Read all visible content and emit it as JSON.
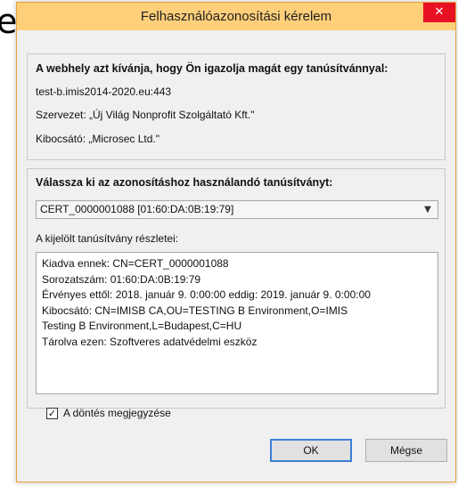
{
  "background": {
    "letter": "e"
  },
  "window": {
    "title": "Felhasználóazonosítási kérelem",
    "close_glyph": "✕",
    "accent_color": "#ffcf7a",
    "close_color": "#e81123"
  },
  "request": {
    "heading": "A webhely azt kívánja, hogy Ön igazolja magát egy tanúsítvánnyal:",
    "host": "test-b.imis2014-2020.eu:443",
    "organization": "Szervezet: „Új Világ Nonprofit Szolgáltató Kft.\"",
    "issuer": "Kibocsátó: „Microsec Ltd.\""
  },
  "certificate": {
    "heading": "Válassza ki az azonosításhoz használandó tanúsítványt:",
    "selected": "CERT_0000001088 [01:60:DA:0B:19:79]",
    "dropdown_icon": "chevron-down-icon",
    "details_label": "A kijelölt tanúsítvány részletei:",
    "details": [
      "Kiadva ennek: CN=CERT_0000001088",
      "Sorozatszám: 01:60:DA:0B:19:79",
      "Érvényes ettől: 2018. január 9. 0:00:00 eddig: 2019. január 9. 0:00:00",
      "Kibocsátó: CN=IMISB CA,OU=TESTING B Environment,O=IMIS",
      "Testing B Environment,L=Budapest,C=HU",
      "Tárolva ezen: Szoftveres adatvédelmi eszköz"
    ]
  },
  "remember": {
    "label": "A döntés megjegyzése",
    "checked": true,
    "check_glyph": "✓"
  },
  "buttons": {
    "ok": "OK",
    "cancel": "Mégse"
  }
}
